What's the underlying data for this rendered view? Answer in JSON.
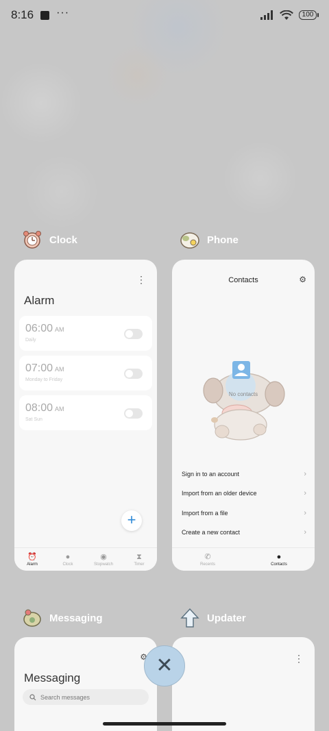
{
  "status_bar": {
    "time": "8:16",
    "dots": "···",
    "battery": "100"
  },
  "apps": {
    "clock": {
      "label": "Clock",
      "header_title": "Alarm",
      "alarms": [
        {
          "time": "06:00",
          "ampm": "AM",
          "repeat": "Daily"
        },
        {
          "time": "07:00",
          "ampm": "AM",
          "repeat": "Monday to Friday"
        },
        {
          "time": "08:00",
          "ampm": "AM",
          "repeat": "Sat Sun"
        }
      ],
      "nav": [
        {
          "label": "Alarm",
          "icon": "alarm-icon",
          "glyph": "⏰"
        },
        {
          "label": "Clock",
          "icon": "clock-icon",
          "glyph": "●"
        },
        {
          "label": "Stopwatch",
          "icon": "stopwatch-icon",
          "glyph": "◉"
        },
        {
          "label": "Timer",
          "icon": "hourglass-icon",
          "glyph": "⧗"
        }
      ],
      "fab": "+"
    },
    "phone": {
      "label": "Phone",
      "header_title": "Contacts",
      "empty_text": "No contacts",
      "menu": [
        "Sign in to an account",
        "Import from an older device",
        "Import from a file",
        "Create a new contact"
      ],
      "nav": [
        {
          "label": "Recents",
          "icon": "phone-icon",
          "glyph": "✆"
        },
        {
          "label": "Contacts",
          "icon": "person-icon",
          "glyph": "●"
        }
      ]
    },
    "messaging": {
      "label": "Messaging",
      "header_title": "Messaging",
      "search_placeholder": "Search messages"
    },
    "updater": {
      "label": "Updater"
    }
  },
  "close_button": "✕",
  "colors": {
    "accent": "#2f8ad7",
    "close_bg": "#b9d3e8"
  }
}
